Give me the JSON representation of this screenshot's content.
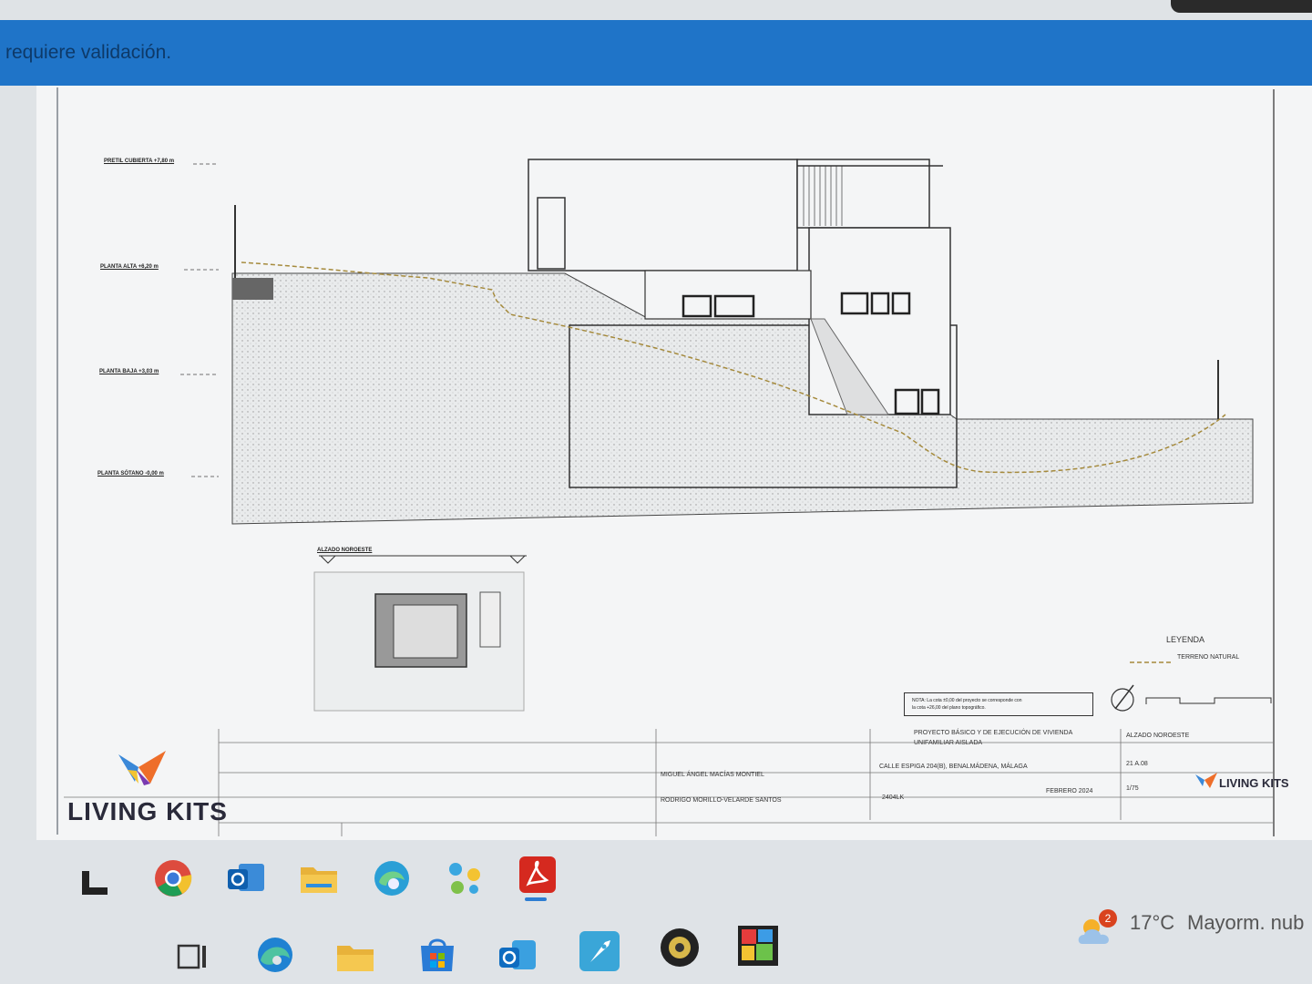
{
  "notice": {
    "text": "requiere validación."
  },
  "levels": [
    {
      "label": "PRETIL CUBIERTA +7,80 m"
    },
    {
      "label": "PLANTA ALTA +6,20 m"
    },
    {
      "label": "PLANTA BAJA +3,03 m"
    },
    {
      "label": "PLANTA SÓTANO -0,00 m"
    }
  ],
  "keyplan": {
    "label": "ALZADO NOROESTE"
  },
  "legend": {
    "title": "LEYENDA",
    "item": "TERRENO NATURAL"
  },
  "note": {
    "line1": "NOTA: La cota ±0,00 del proyecto se corresponde con",
    "line2": "la cota +26,00 del plano topográfico."
  },
  "title_block": {
    "company": "LIVING KITS",
    "project": "PROYECTO BÁSICO Y DE EJECUCIÓN DE VIVIENDA",
    "project2": "UNIFAMILIAR AISLADA",
    "location": "CALLE ESPIGA 204(B), BENALMÁDENA, MÁLAGA",
    "architect1": "MIGUEL ÁNGEL MACÍAS MONTIEL",
    "architect2": "RODRIGO MORILLO-VELARDE SANTOS",
    "sheet_title": "ALZADO NOROESTE",
    "sheet_num": "21 A.08",
    "code": "2404LK",
    "date": "FEBRERO 2024",
    "scale": "1/75"
  },
  "taskbar": {
    "pinned": [
      {
        "icon": "widgets-icon"
      },
      {
        "icon": "chrome-icon"
      },
      {
        "icon": "outlook-icon"
      },
      {
        "icon": "file-explorer-icon"
      },
      {
        "icon": "edge-dev-icon"
      },
      {
        "icon": "power-automate-icon"
      },
      {
        "icon": "acrobat-icon"
      }
    ],
    "bottom": [
      {
        "icon": "task-view-icon"
      },
      {
        "icon": "edge-icon"
      },
      {
        "icon": "file-explorer-icon"
      },
      {
        "icon": "store-icon"
      },
      {
        "icon": "outlook-new-icon"
      },
      {
        "icon": "rocket-app-icon"
      },
      {
        "icon": "disc-app-icon"
      },
      {
        "icon": "puzzle-app-icon"
      }
    ],
    "weather": {
      "temp": "17°C",
      "desc": "Mayorm. nub",
      "badge": "2"
    }
  },
  "colors": {
    "accent": "#1f74c8",
    "terrain": "#a58a3c"
  }
}
